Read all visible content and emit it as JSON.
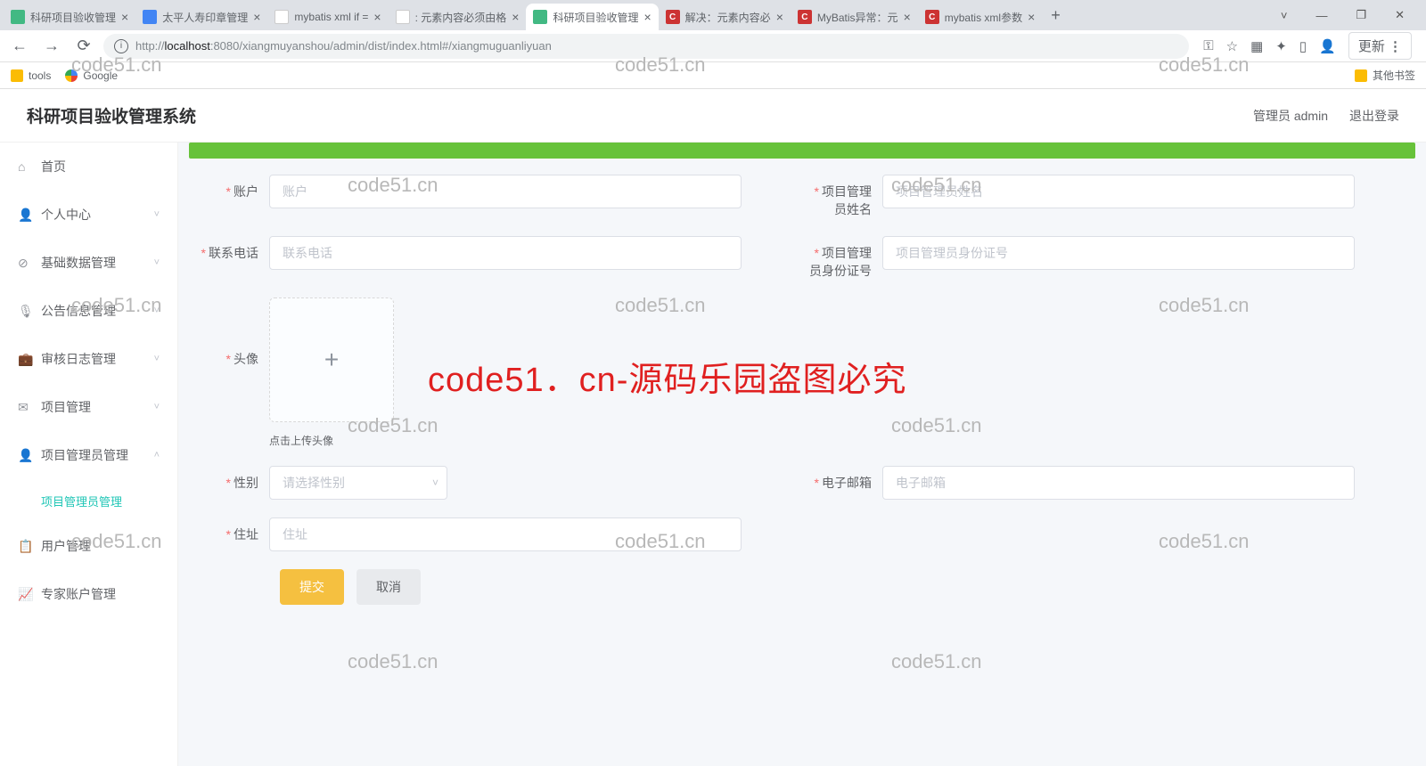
{
  "browser": {
    "tabs": [
      {
        "title": "科研项目验收管理",
        "fav": "green"
      },
      {
        "title": "太平人寿印章管理",
        "fav": "blue"
      },
      {
        "title": "mybatis xml if =",
        "fav": "paw"
      },
      {
        "title": ": 元素内容必须由格",
        "fav": "paw"
      },
      {
        "title": "科研项目验收管理",
        "fav": "green",
        "active": true
      },
      {
        "title": "解决：元素内容必",
        "fav": "red"
      },
      {
        "title": "MyBatis异常：元",
        "fav": "red"
      },
      {
        "title": "mybatis xml参数",
        "fav": "red"
      }
    ],
    "url_host": "localhost",
    "url_prefix": "http://",
    "url_port_path": ":8080/xiangmuyanshou/admin/dist/index.html#/xiangmuguanliyuan",
    "update_label": "更新",
    "bookmarks": {
      "tools": "tools",
      "google": "Google",
      "other": "其他书签"
    }
  },
  "app": {
    "title": "科研项目验收管理系统",
    "admin_label": "管理员 admin",
    "logout_label": "退出登录"
  },
  "sidebar": {
    "items": [
      {
        "icon": "⌂",
        "label": "首页"
      },
      {
        "icon": "👤",
        "label": "个人中心",
        "arrow": "˅"
      },
      {
        "icon": "⊘",
        "label": "基础数据管理",
        "arrow": "˅"
      },
      {
        "icon": "🎤",
        "label": "公告信息管理",
        "arrow": "˅"
      },
      {
        "icon": "💼",
        "label": "审核日志管理",
        "arrow": "˅"
      },
      {
        "icon": "✉",
        "label": "项目管理",
        "arrow": "˅"
      },
      {
        "icon": "👤",
        "label": "项目管理员管理",
        "arrow": "˄"
      },
      {
        "icon": "📋",
        "label": "用户管理"
      },
      {
        "icon": "📊",
        "label": "专家账户管理"
      }
    ],
    "submenu_active": "项目管理员管理"
  },
  "form": {
    "account": {
      "label": "账户",
      "placeholder": "账户"
    },
    "pm_name": {
      "label": "项目管理员姓名",
      "placeholder": "项目管理员姓名"
    },
    "phone": {
      "label": "联系电话",
      "placeholder": "联系电话"
    },
    "pm_id": {
      "label": "项目管理员身份证号",
      "placeholder": "项目管理员身份证号"
    },
    "avatar": {
      "label": "头像",
      "hint": "点击上传头像"
    },
    "gender": {
      "label": "性别",
      "placeholder": "请选择性别"
    },
    "email": {
      "label": "电子邮箱",
      "placeholder": "电子邮箱"
    },
    "address": {
      "label": "住址",
      "placeholder": "住址"
    },
    "submit": "提交",
    "cancel": "取消"
  },
  "watermark": {
    "text": "code51.cn",
    "red": "code51．cn-源码乐园盗图必究"
  }
}
